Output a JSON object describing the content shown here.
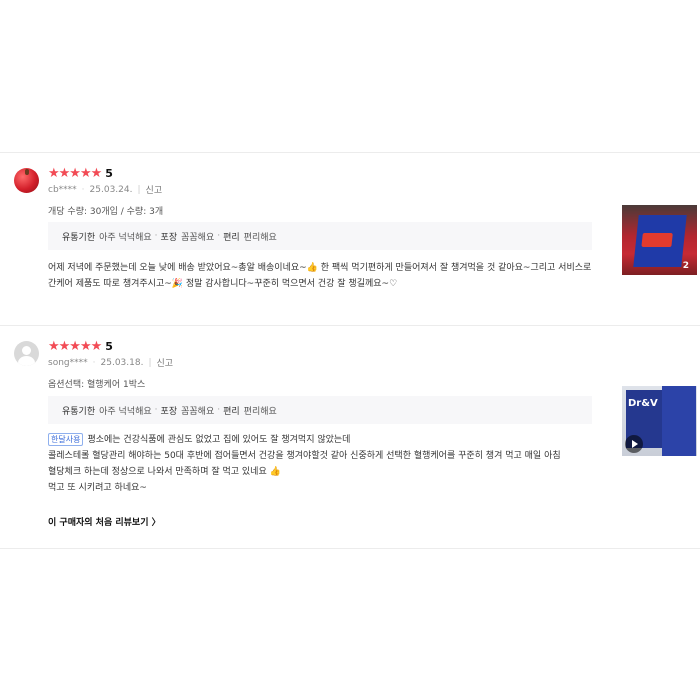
{
  "reviews": [
    {
      "stars": "★★★★★",
      "score": "5",
      "user": "cb****",
      "date": "25.03.24.",
      "report": "신고",
      "option": "개당 수량: 30개입 / 수량: 3개",
      "tags": [
        {
          "label": "유통기한",
          "value": "아주 넉넉해요"
        },
        {
          "label": "포장",
          "value": "꼼꼼해요"
        },
        {
          "label": "편리",
          "value": "편리해요"
        }
      ],
      "body": "어제 저녁에 주문했는데 오늘 낮에 배송 받았어요~총알 배송이네요~👍 한 팩씩 먹기편하게 만들어져서 잘 챙겨먹을 것 같아요~그리고 서비스로 간케어 제품도 따로 챙겨주시고~🎉 정말 감사합니다~꾸준히 먹으면서 건강 잘 챙길께요~♡",
      "thumb_count": "2"
    },
    {
      "stars": "★★★★★",
      "score": "5",
      "user": "song****",
      "date": "25.03.18.",
      "report": "신고",
      "option": "옵션선택: 혈행케어 1박스",
      "tags": [
        {
          "label": "유통기한",
          "value": "아주 넉넉해요"
        },
        {
          "label": "포장",
          "value": "꼼꼼해요"
        },
        {
          "label": "편리",
          "value": "편리해요"
        }
      ],
      "badge": "한달사용",
      "body_lines": [
        "평소에는 건강식품에 관심도 없었고 집에 있어도 잘 챙겨먹지 않았는데",
        "콜레스테롤 혈당관리 해야하는 50대 후반에 접어들면서 건강을 챙겨야할것 같아 신중하게 선택한 혈행케어를 꾸준히 챙겨 먹고 매일 아침 혈당체크 하는데 정상으로 나와서 만족하며 잘 먹고 있네요 👍",
        "먹고 또 시키려고 하네요~"
      ],
      "thumb_label": "Dr&V",
      "first_review_link": "이 구매자의 처음 리뷰보기 〉"
    }
  ],
  "colors": {
    "star": "#f24b55",
    "badge": "#3a6bd8",
    "tag_bg": "#f7f7f9"
  }
}
